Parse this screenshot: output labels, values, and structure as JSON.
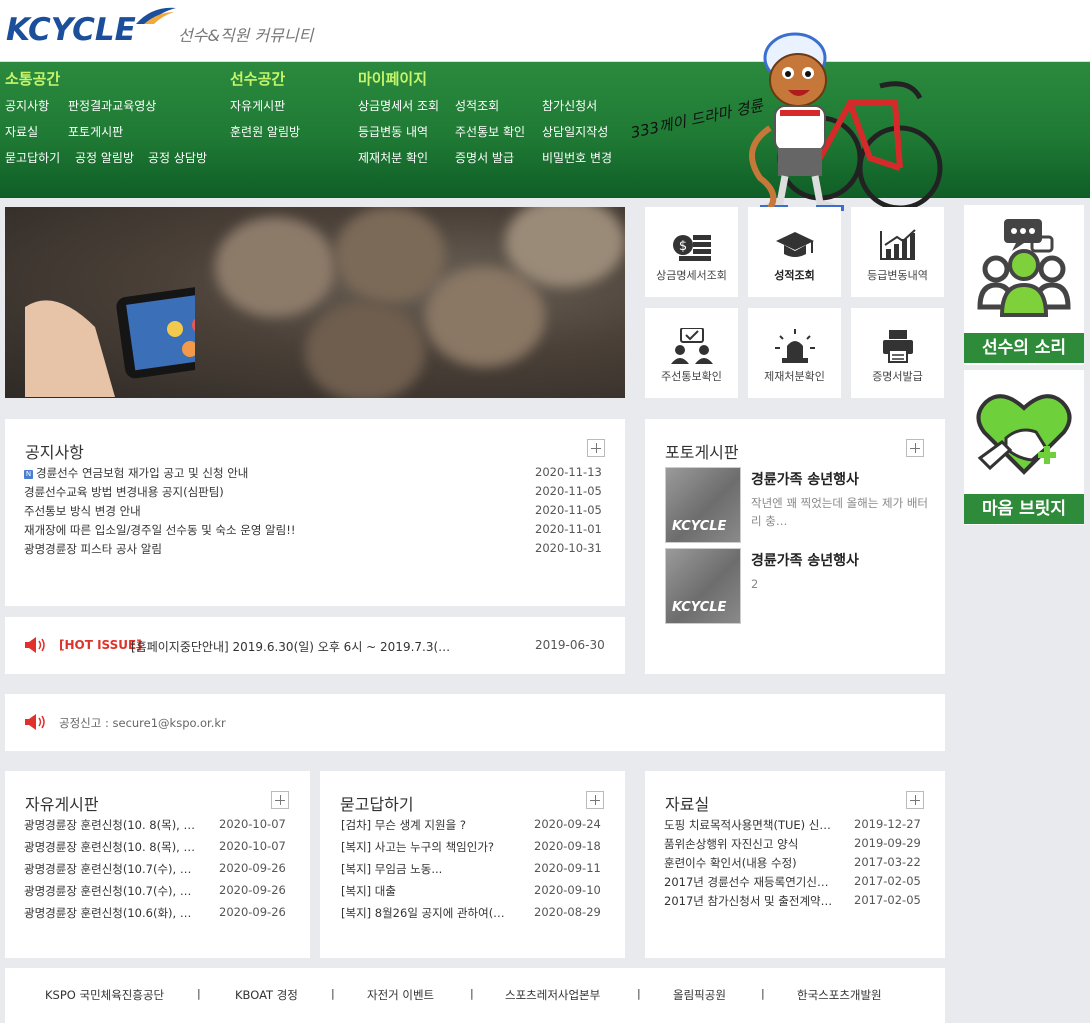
{
  "header": {
    "logo_text": "KCYCLE",
    "subtitle": "선수&직원 커뮤니티"
  },
  "nav": {
    "col1": {
      "title": "소통공간",
      "links": [
        "공지사항",
        "판정결과교육영상",
        "자료실",
        "포토게시판",
        "묻고답하기",
        "공정 알림방",
        "공정 상담방"
      ]
    },
    "col2": {
      "title": "선수공간",
      "links": [
        "자유게시판",
        "훈련원 알림방"
      ]
    },
    "col3": {
      "title": "마이페이지",
      "links": [
        "상금명세서 조회",
        "성적조회",
        "참가신청서",
        "등급변동 내역",
        "주선통보 확인",
        "상담일지작성",
        "제재처분 확인",
        "증명서 발급",
        "비밀번호 변경"
      ]
    },
    "mascot_text": "333께이 드라마 경륜"
  },
  "tiles": [
    {
      "label": "상금명세서조회",
      "icon": "money-stack-icon"
    },
    {
      "label": "성적조회",
      "icon": "graduation-cap-icon"
    },
    {
      "label": "등급변동내역",
      "icon": "bar-chart-icon"
    },
    {
      "label": "주선통보확인",
      "icon": "people-check-icon"
    },
    {
      "label": "제재처분확인",
      "icon": "siren-icon"
    },
    {
      "label": "증명서발급",
      "icon": "printer-icon"
    }
  ],
  "side": {
    "voice_label": "선수의 소리",
    "bridge_label": "마음 브릿지"
  },
  "notice": {
    "title": "공지사항",
    "new_badge": "N",
    "items": [
      {
        "title": "경륜선수 연금보험 재가입 공고 및 신청 안내",
        "date": "2020-11-13",
        "new": true
      },
      {
        "title": "경륜선수교육 방법 변경내용 공지(심판팀)",
        "date": "2020-11-05"
      },
      {
        "title": "주선통보 방식 변경 안내",
        "date": "2020-11-05"
      },
      {
        "title": "재개장에 따른 입소일/경주일 선수동 및 숙소 운영 알림!!",
        "date": "2020-11-01"
      },
      {
        "title": "광명경륜장 피스타 공사 알림",
        "date": "2020-10-31"
      }
    ]
  },
  "hot_issue": {
    "tag": "[HOT ISSUE]",
    "text": "[홈페이지중단안내] 2019.6.30(일) 오후 6시 ~ 2019.7.3(…",
    "date": "2019-06-30"
  },
  "report": {
    "text": "공정신고 : secure1@kspo.or.kr"
  },
  "photo": {
    "title": "포토게시판",
    "items": [
      {
        "title": "경륜가족 송년행사",
        "desc": "작년엔 꽤 찍었는데 올해는 제가 배터리 충…",
        "thumb_text": "KCYCLE"
      },
      {
        "title": "경륜가족 송년행사",
        "desc": "2",
        "thumb_text": "KCYCLE"
      }
    ]
  },
  "free": {
    "title": "자유게시판",
    "items": [
      {
        "title": "광명경륜장 훈련신청(10. 8(목), …",
        "date": "2020-10-07"
      },
      {
        "title": "광명경륜장 훈련신청(10. 8(목), …",
        "date": "2020-10-07"
      },
      {
        "title": "광명경륜장 훈련신청(10.7(수), …",
        "date": "2020-09-26"
      },
      {
        "title": "광명경륜장 훈련신청(10.7(수), …",
        "date": "2020-09-26"
      },
      {
        "title": "광명경륜장 훈련신청(10.6(화), …",
        "date": "2020-09-26"
      }
    ]
  },
  "qna": {
    "title": "묻고답하기",
    "items": [
      {
        "title": "[검차] 무슨 생계 지원을 ?",
        "date": "2020-09-24"
      },
      {
        "title": "[복지] 사고는 누구의 책임인가?",
        "date": "2020-09-18"
      },
      {
        "title": "[복지] 무임금 노동...",
        "date": "2020-09-11"
      },
      {
        "title": "[복지] 대출",
        "date": "2020-09-10"
      },
      {
        "title": "[복지] 8월26일 공지에 관하여(…",
        "date": "2020-08-29"
      }
    ]
  },
  "library": {
    "title": "자료실",
    "items": [
      {
        "title": "도핑 치료목적사용면책(TUE) 신…",
        "date": "2019-12-27"
      },
      {
        "title": "품위손상행위 자진신고 양식",
        "date": "2019-09-29"
      },
      {
        "title": "훈련이수 확인서(내용 수정)",
        "date": "2017-03-22"
      },
      {
        "title": "2017년 경륜선수 재등록연기신…",
        "date": "2017-02-05"
      },
      {
        "title": "2017년 참가신청서 및 출전계약…",
        "date": "2017-02-05"
      }
    ]
  },
  "footer": {
    "links": [
      "KSPO 국민체육진흥공단",
      "KBOAT 경정",
      "자전거 이벤트",
      "스포츠레저사업본부",
      "올림픽공원",
      "한국스포츠개발원"
    ],
    "separator": "|"
  },
  "colors": {
    "nav_green": "#1f7a34",
    "nav_head": "#c6f46b",
    "side_green": "#2e8b3a",
    "hot_red": "#e0322b"
  }
}
